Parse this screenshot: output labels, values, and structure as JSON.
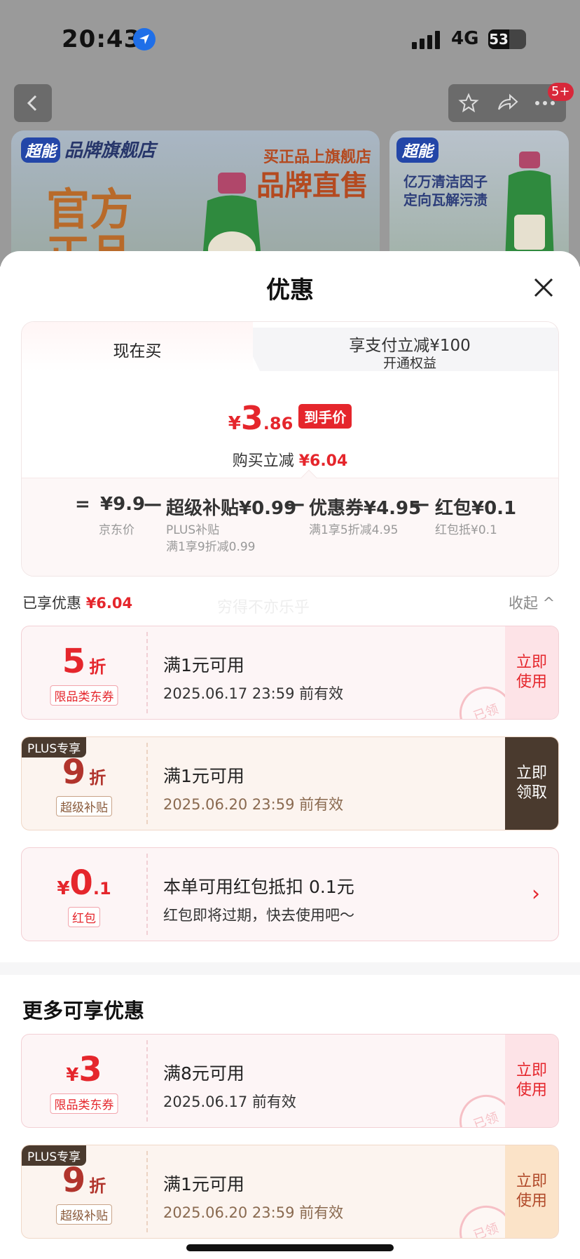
{
  "status_bar": {
    "time": "20:43",
    "network": "4G",
    "battery": "53"
  },
  "background_page": {
    "message_badge": "5+",
    "banner1": {
      "brand": "品牌旗舰店",
      "logo": "超能",
      "headline": "官方正品",
      "slogan_top": "买正品上旗舰店",
      "slogan_main": "品牌直售"
    },
    "banner2": {
      "logo": "超能",
      "text_line1": "亿万清洁因子",
      "text_line2": "定向瓦解污渍"
    }
  },
  "sheet": {
    "title": "优惠",
    "tabs": {
      "now": "现在买",
      "pay_line1": "享支付立减¥100",
      "pay_line2": "开通权益"
    },
    "price": {
      "symbol": "¥",
      "int": "3",
      "dec": ".86",
      "tag": "到手价",
      "save_label": "购买立减",
      "save_value": "¥6.04"
    },
    "calc": {
      "eq": "=",
      "jd_price": "¥9.9",
      "jd_price_sub": "京东价",
      "minus": "—",
      "subsidy": "超级补贴¥0.99",
      "subsidy_sub1": "PLUS补贴",
      "subsidy_sub2": "满1享9折减0.99",
      "coupon": "优惠券¥4.95",
      "coupon_sub": "满1享5折减4.95",
      "redpacket": "红包¥0.1",
      "redpacket_sub": "红包抵¥0.1"
    },
    "enjoyed_label": "已享优惠",
    "enjoyed_value": "¥6.04",
    "watermark": "穷得不亦乐乎",
    "collapse_label": "收起 ^",
    "coupons": [
      {
        "value": "5",
        "unit": "折",
        "tag": "限品类东券",
        "line1": "满1元可用",
        "line2": "2025.06.17 23:59 前有效",
        "btn": "立即使用",
        "stamp": "已领"
      },
      {
        "plus": "PLUS专享",
        "value": "9",
        "unit": "折",
        "tag": "超级补贴",
        "line1": "满1元可用",
        "line2": "2025.06.20 23:59 前有效",
        "btn": "立即领取"
      },
      {
        "symbol": "¥",
        "value": "0",
        "dec": ".1",
        "tag": "红包",
        "line1": "本单可用红包抵扣 0.1元",
        "line2": "红包即将过期，快去使用吧～"
      }
    ],
    "more_title": "更多可享优惠",
    "more_coupons": [
      {
        "symbol": "¥",
        "value": "3",
        "tag": "限品类东券",
        "line1": "满8元可用",
        "line2": "2025.06.17 前有效",
        "btn": "立即使用",
        "stamp": "已领"
      },
      {
        "plus": "PLUS专享",
        "value": "9",
        "unit": "折",
        "tag": "超级补贴",
        "line1": "满1元可用",
        "line2": "2025.06.20 23:59 前有效",
        "btn": "立即使用",
        "stamp": "已领"
      }
    ]
  },
  "colors": {
    "accent": "#e5262c",
    "plus_dark": "#4a3a2e"
  }
}
